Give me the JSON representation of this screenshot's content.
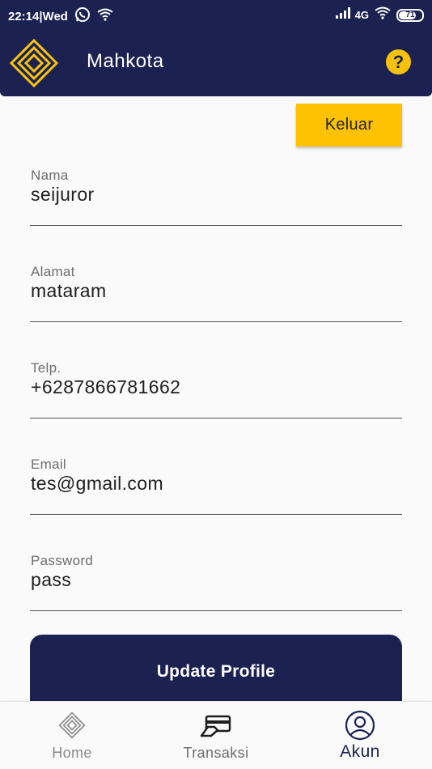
{
  "status_bar": {
    "time": "22:14|Wed",
    "network": "4G",
    "battery": "71",
    "battery_level": 0.71,
    "icons": [
      "whatsapp-icon",
      "wifi-icon",
      "signal-icon",
      "wifi-icon",
      "battery-icon"
    ]
  },
  "app_bar": {
    "title": "Mahkota",
    "help_icon": "?"
  },
  "logout_label": "Keluar",
  "fields": {
    "nama": {
      "label": "Nama",
      "value": "seijuror"
    },
    "alamat": {
      "label": "Alamat",
      "value": "mataram"
    },
    "telp": {
      "label": "Telp.",
      "value": "+6287866781662"
    },
    "email": {
      "label": "Email",
      "value": "tes@gmail.com"
    },
    "password": {
      "label": "Password",
      "value": "pass"
    }
  },
  "update_button_label": "Update Profile",
  "bottom_nav": {
    "items": [
      {
        "label": "Home",
        "icon": "mahkota-logo-icon",
        "active": false
      },
      {
        "label": "Transaksi",
        "icon": "payment-card-icon",
        "active": false
      },
      {
        "label": "Akun",
        "icon": "user-circle-icon",
        "active": true
      }
    ]
  },
  "colors": {
    "primary": "#1b2150",
    "accent": "#fdc204",
    "background": "#fafafa"
  }
}
